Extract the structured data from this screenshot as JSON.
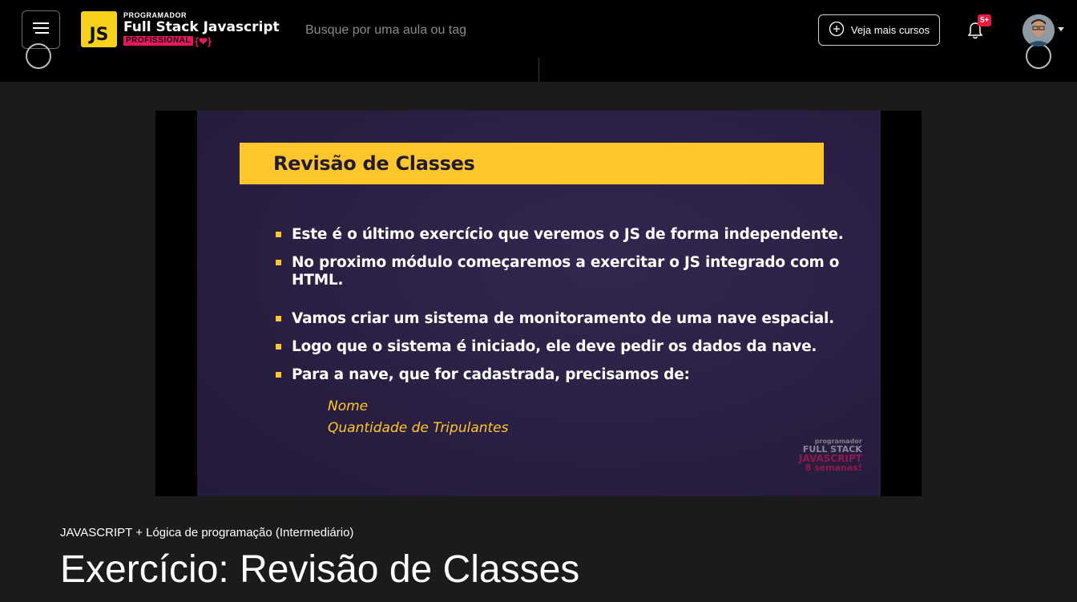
{
  "header": {
    "logo": {
      "small": "PROGRAMADOR",
      "main": "Full Stack Javascript",
      "tag": "PROFISSIONAL",
      "brace": "{❤}",
      "js": "JS"
    },
    "search_placeholder": "Busque por uma aula ou tag",
    "courses_button": "Veja mais cursos",
    "notification_badge": "5+"
  },
  "slide": {
    "title": "Revisão de Classes",
    "bullets": [
      "Este é o último exercício que veremos o JS de forma independente.",
      "No proximo módulo começaremos a exercitar o JS integrado com o HTML.",
      "Vamos criar um sistema de monitoramento de uma nave espacial.",
      "Logo que o sistema é iniciado, ele deve pedir os dados da nave.",
      "Para a nave, que for cadastrada, precisamos de:"
    ],
    "fields": [
      "Nome",
      "Quantidade de Tripulantes"
    ],
    "watermark": {
      "line1": "programador",
      "line2": "FULL STACK",
      "line3": "JAVASCRIPT",
      "line4": "8 semanas!"
    }
  },
  "lesson": {
    "course": "JAVASCRIPT + Lógica de programação (Intermediário)",
    "title": "Exercício: Revisão de Classes"
  },
  "colors": {
    "accent": "#ffc72c",
    "brand_pink": "#e5195b",
    "badge": "#e8193f"
  }
}
